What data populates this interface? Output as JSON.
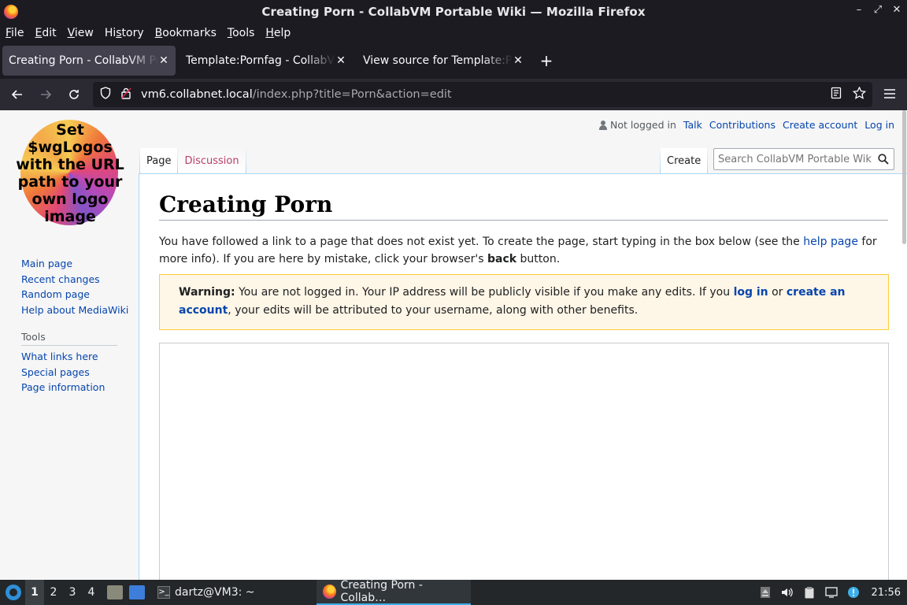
{
  "window": {
    "title": "Creating Porn - CollabVM Portable Wiki — Mozilla Firefox",
    "controls": [
      "–",
      "⤢",
      "✕"
    ]
  },
  "menu": [
    "File",
    "Edit",
    "View",
    "History",
    "Bookmarks",
    "Tools",
    "Help"
  ],
  "menu_access": [
    "F",
    "E",
    "V",
    "s",
    "B",
    "T",
    "H"
  ],
  "tabs": [
    {
      "label": "Creating Porn - CollabVM Portable Wiki",
      "active": true
    },
    {
      "label": "Template:Pornfag - CollabVM Portable Wiki",
      "active": false
    },
    {
      "label": "View source for Template:Pornfag",
      "active": false
    }
  ],
  "nav": {
    "url_host": "vm6.collabnet.local",
    "url_path": "/index.php?title=Porn&action=edit"
  },
  "wiki": {
    "logo_text": [
      "Set",
      "$wgLogos",
      "with the URL",
      "path to your",
      "own logo",
      "image"
    ],
    "personal": {
      "not_logged_in": "Not logged in",
      "talk": "Talk",
      "contributions": "Contributions",
      "create_account": "Create account",
      "log_in": "Log in"
    },
    "namespace_tabs": {
      "page": "Page",
      "discussion": "Discussion"
    },
    "view_tabs": {
      "create": "Create"
    },
    "search_placeholder": "Search CollabVM Portable Wiki",
    "navigation": [
      "Main page",
      "Recent changes",
      "Random page",
      "Help about MediaWiki"
    ],
    "tools_heading": "Tools",
    "tools": [
      "What links here",
      "Special pages",
      "Page information"
    ],
    "heading": "Creating Porn",
    "intro": {
      "part1": "You have followed a link to a page that does not exist yet. To create the page, start typing in the box below (see the ",
      "help_link": "help page",
      "part2": " for more info). If you are here by mistake, click your browser's ",
      "back_bold": "back",
      "part3": " button."
    },
    "warning": {
      "label": "Warning:",
      "part1": " You are not logged in. Your IP address will be publicly visible if you make any edits. If you ",
      "log_in": "log in",
      "or": " or ",
      "create_account": "create an account",
      "part2": ", your edits will be attributed to your username, along with other benefits."
    }
  },
  "taskbar": {
    "workspaces": [
      "1",
      "2",
      "3",
      "4"
    ],
    "tasks": [
      {
        "label": "dartz@VM3: ~",
        "icon": "terminal-icon"
      },
      {
        "label": "Creating Porn - Collab…",
        "icon": "firefox-icon"
      }
    ],
    "clock": "21:56"
  },
  "colors": {
    "link": "#0645ad",
    "new_link": "#ba3e6a",
    "warning_bg": "#fef6e7",
    "warning_border": "#ffcc33",
    "chrome_dark": "#1c1b22"
  }
}
